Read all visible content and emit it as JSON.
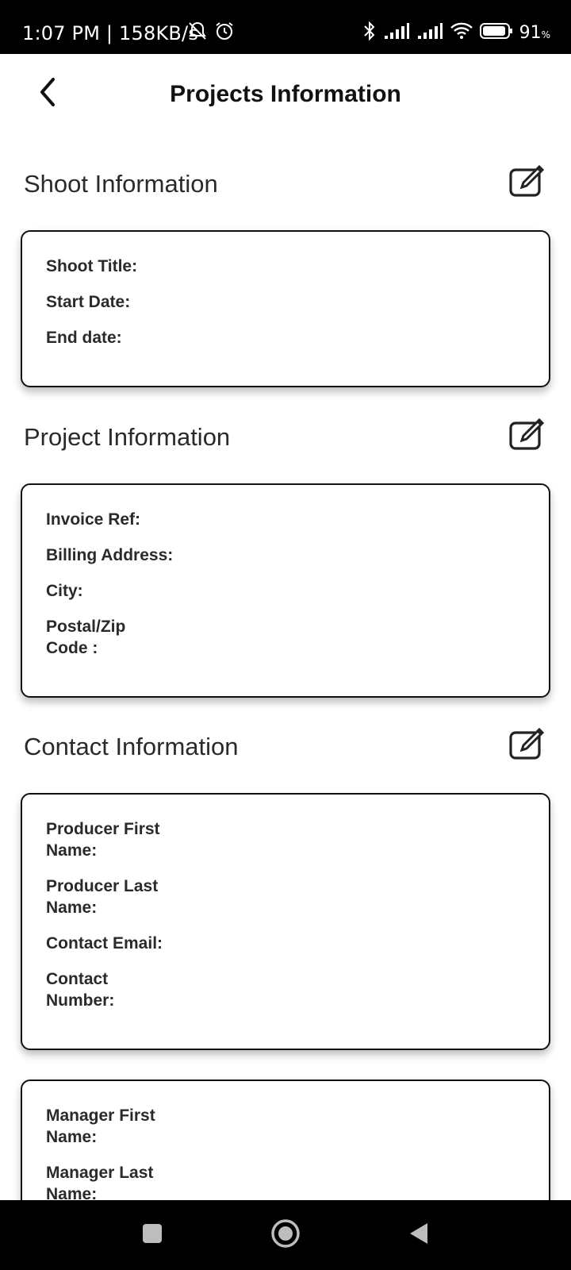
{
  "status_bar": {
    "time": "1:07 PM | 158KB/s",
    "battery": "91",
    "battery_unit": "%",
    "icons": [
      "notification-off-icon",
      "alarm-icon",
      "bluetooth-icon",
      "signal-icon",
      "signal-icon",
      "wifi-icon",
      "battery-icon"
    ]
  },
  "header": {
    "title": "Projects Information",
    "back_icon": "chevron-left-icon"
  },
  "sections": {
    "shoot": {
      "title": "Shoot Information",
      "fields": [
        "Shoot Title:",
        "Start Date:",
        "End date:"
      ]
    },
    "project": {
      "title": "Project Information",
      "fields": [
        "Invoice Ref:",
        "Billing Address:",
        "City:",
        "Postal/Zip Code :"
      ]
    },
    "contact": {
      "title": "Contact Information",
      "fields": [
        "Producer First Name:",
        "Producer Last Name:",
        "Contact Email:",
        "Contact Number:"
      ]
    },
    "manager": {
      "fields": [
        "Manager First Name:",
        "Manager Last Name:"
      ]
    }
  },
  "nav_bar": {
    "icons": [
      "recent-apps-icon",
      "home-icon",
      "back-icon"
    ]
  }
}
